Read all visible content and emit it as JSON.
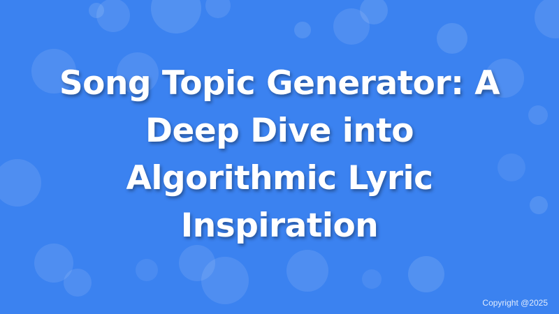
{
  "banner": {
    "title": "Song Topic Generator: A Deep Dive into Algorithmic Lyric Inspiration",
    "copyright": "Copyright @2025"
  },
  "colors": {
    "background": "#3b82f0",
    "text": "#ffffff",
    "bubble": "#ffffff"
  }
}
